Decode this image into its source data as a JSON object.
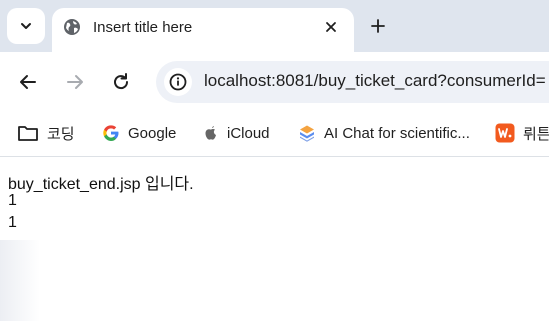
{
  "tab": {
    "title": "Insert title here"
  },
  "omnibox": {
    "url": "localhost:8081/buy_ticket_card?consumerId="
  },
  "bookmarks": [
    {
      "label": "코딩",
      "icon": "folder-icon"
    },
    {
      "label": "Google",
      "icon": "google-icon"
    },
    {
      "label": "iCloud",
      "icon": "apple-icon"
    },
    {
      "label": "AI Chat for scientific...",
      "icon": "ai-chat-icon"
    },
    {
      "label": "뤼튼",
      "icon": "wrtn-icon"
    }
  ],
  "page": {
    "lines": [
      "buy_ticket_end.jsp 입니다.",
      "1",
      "1"
    ]
  },
  "colors": {
    "tabstrip": "#dfe5ee",
    "omnibox": "#eef1f7",
    "text": "#1f1f1f"
  }
}
